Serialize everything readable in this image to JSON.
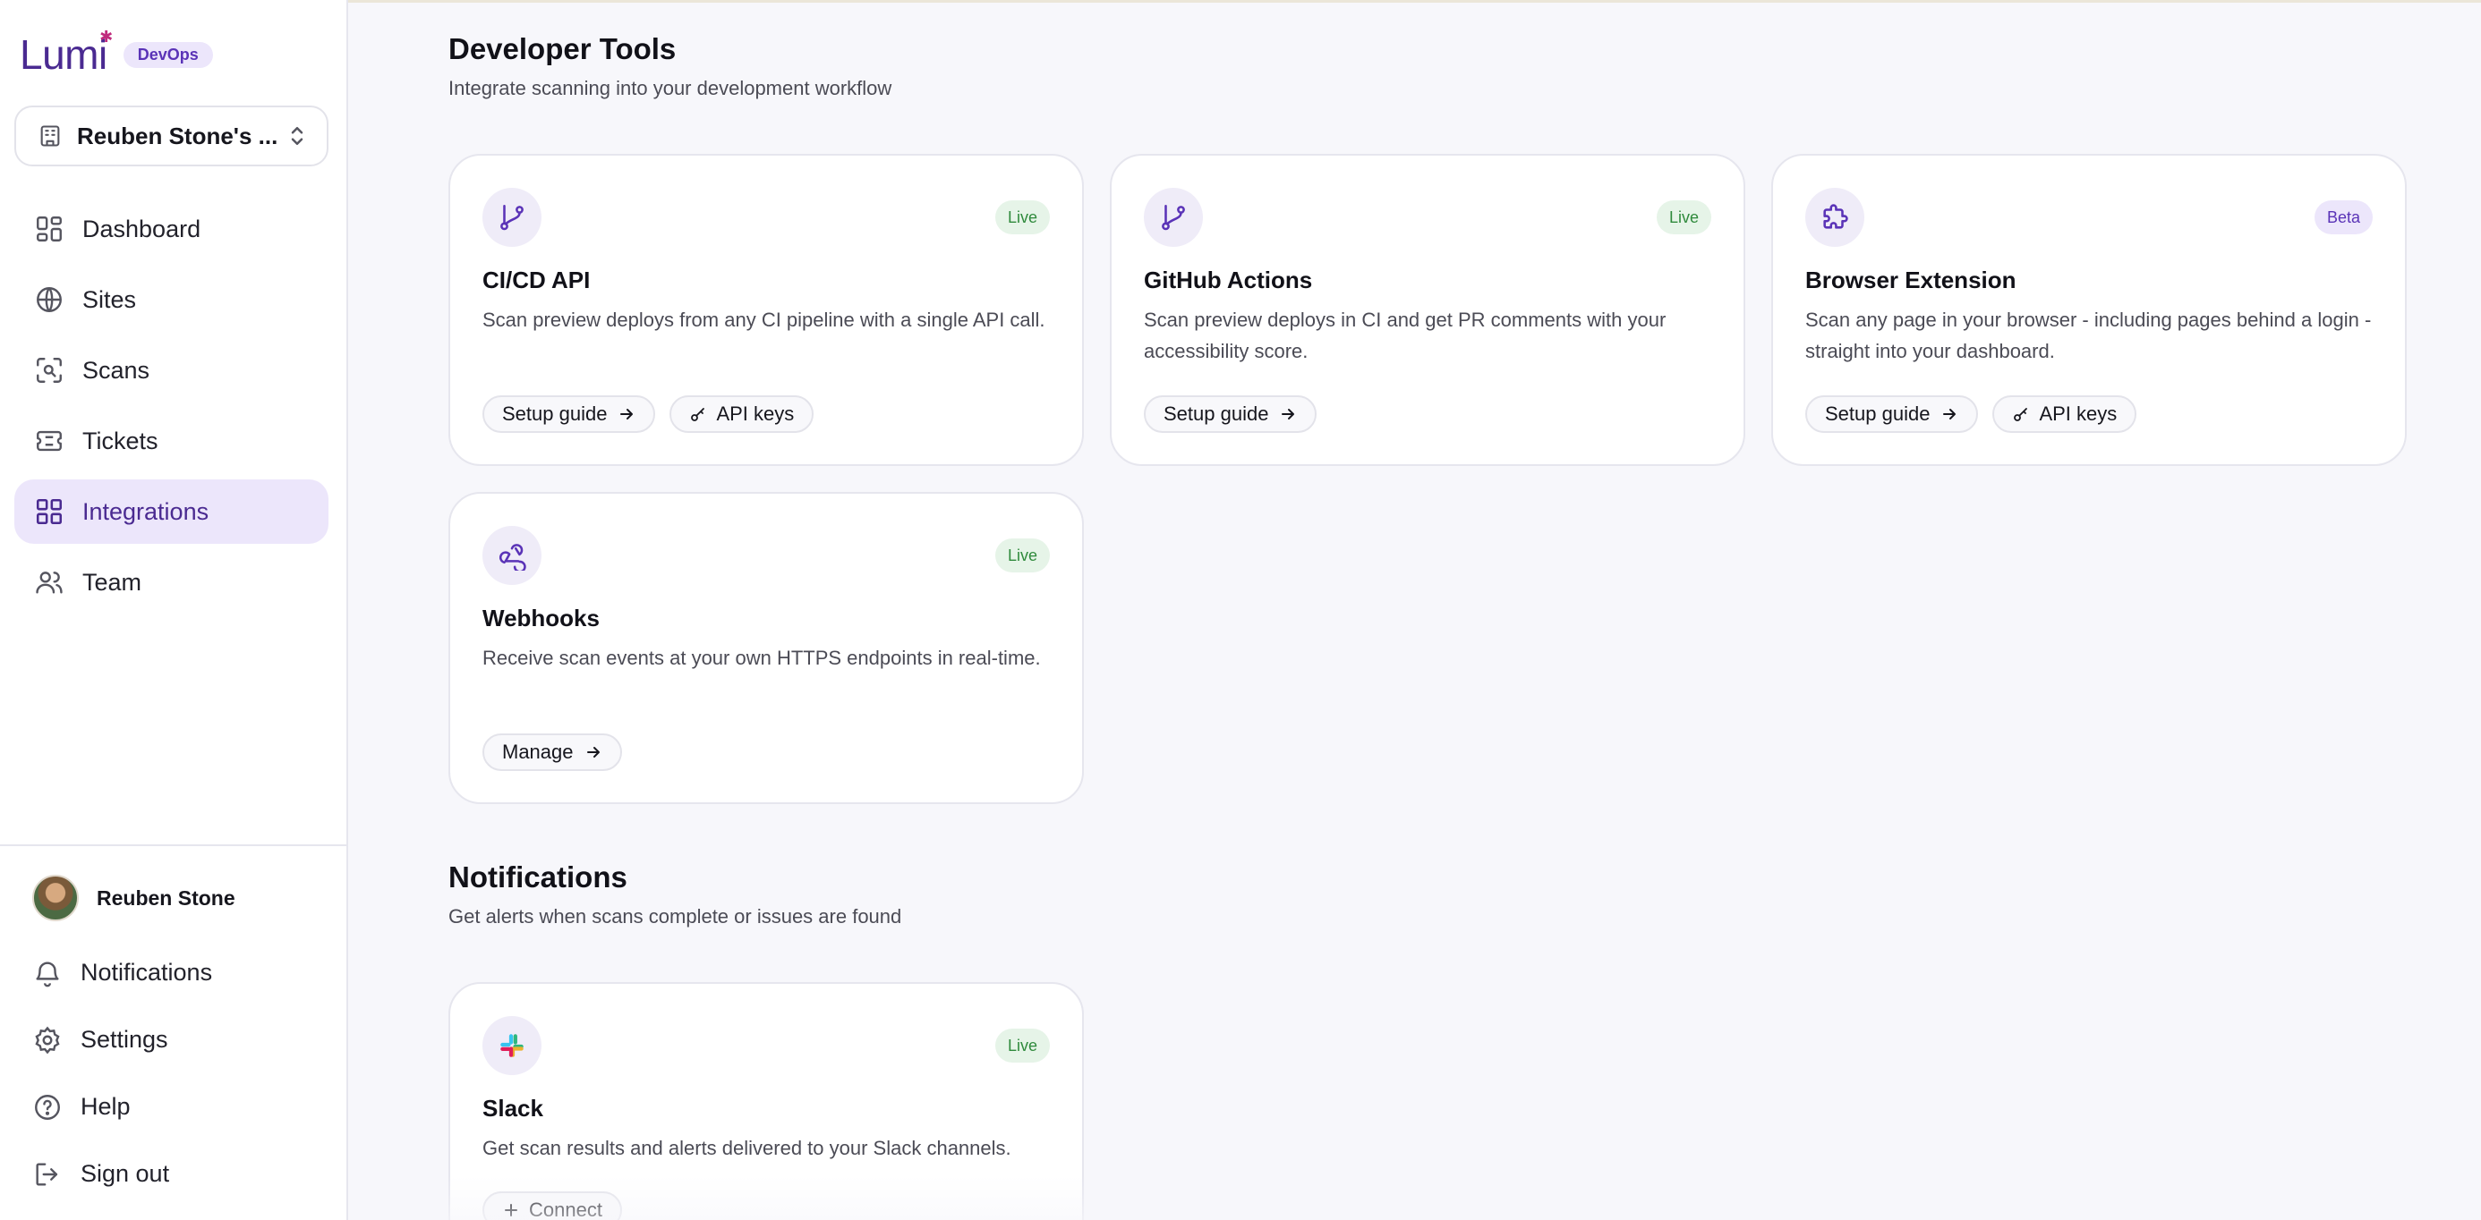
{
  "brand": {
    "logo": "Lumi",
    "badge": "DevOps",
    "accent": "#4a2a91",
    "badge_bg": "#ece6fb"
  },
  "workspace": {
    "name": "Reuben Stone's ...",
    "icon": "building-icon",
    "chevron": "chevron-up-down-icon"
  },
  "nav": {
    "items": [
      {
        "label": "Dashboard",
        "icon": "dashboard-icon"
      },
      {
        "label": "Sites",
        "icon": "globe-icon"
      },
      {
        "label": "Scans",
        "icon": "scan-icon"
      },
      {
        "label": "Tickets",
        "icon": "ticket-icon"
      },
      {
        "label": "Integrations",
        "icon": "integrations-icon",
        "active": true
      },
      {
        "label": "Team",
        "icon": "team-icon"
      }
    ]
  },
  "user": {
    "name": "Reuben Stone"
  },
  "bottom_nav": {
    "items": [
      {
        "label": "Notifications",
        "icon": "bell-icon"
      },
      {
        "label": "Settings",
        "icon": "gear-icon"
      },
      {
        "label": "Help",
        "icon": "help-icon"
      },
      {
        "label": "Sign out",
        "icon": "sign-out-icon"
      }
    ]
  },
  "developer_tools": {
    "title": "Developer Tools",
    "subtitle": "Integrate scanning into your development workflow",
    "cards": [
      {
        "title": "CI/CD API",
        "badge": "Live",
        "icon": "git-branch-icon",
        "description": "Scan preview deploys from any CI pipeline with a single API call.",
        "actions": [
          "Setup guide",
          "API keys"
        ]
      },
      {
        "title": "GitHub Actions",
        "badge": "Live",
        "icon": "git-branch-icon",
        "description": "Scan preview deploys in CI and get PR comments with your accessibility score.",
        "actions": [
          "Setup guide"
        ]
      },
      {
        "title": "Browser Extension",
        "badge": "Beta",
        "icon": "puzzle-icon",
        "description": "Scan any page in your browser - including pages behind a login - straight into your dashboard.",
        "actions": [
          "Setup guide",
          "API keys"
        ]
      },
      {
        "title": "Webhooks",
        "badge": "Live",
        "icon": "webhook-icon",
        "description": "Receive scan events at your own HTTPS endpoints in real-time.",
        "actions": [
          "Manage"
        ]
      }
    ]
  },
  "notifications": {
    "title": "Notifications",
    "subtitle": "Get alerts when scans complete or issues are found",
    "cards": [
      {
        "title": "Slack",
        "badge": "Live",
        "icon": "slack-icon",
        "description": "Get scan results and alerts delivered to your Slack channels.",
        "actions": [
          "Connect"
        ]
      }
    ]
  },
  "colors": {
    "live_bg": "#e6f4e8",
    "live_fg": "#2f8a3c",
    "beta_bg": "#ece6fb",
    "beta_fg": "#5a33b7"
  }
}
